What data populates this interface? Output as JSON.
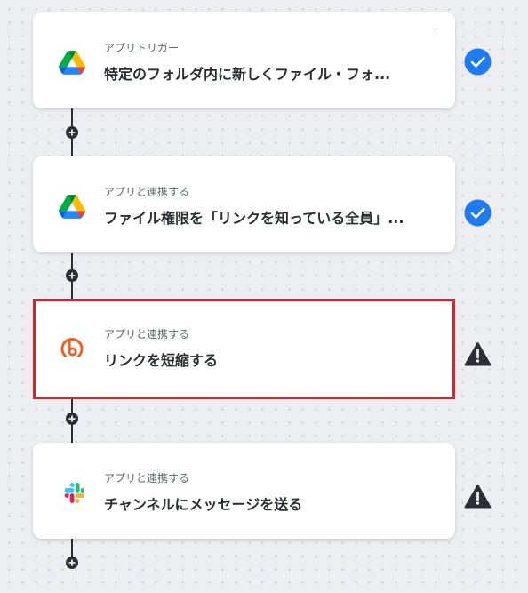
{
  "flow": {
    "steps": [
      {
        "subtitle": "アプリトリガー",
        "title": "特定のフォルダ内に新しくファイル・フォ...",
        "app_icon": "google-drive-icon",
        "status": "complete"
      },
      {
        "subtitle": "アプリと連携する",
        "title": "ファイル権限を「リンクを知っている全員」...",
        "app_icon": "google-drive-icon",
        "status": "complete"
      },
      {
        "subtitle": "アプリと連携する",
        "title": "リンクを短縮する",
        "app_icon": "bitly-icon",
        "status": "warning",
        "highlighted": true
      },
      {
        "subtitle": "アプリと連携する",
        "title": "チャンネルにメッセージを送る",
        "app_icon": "slack-icon",
        "status": "warning"
      }
    ]
  },
  "colors": {
    "complete": "#1e7bf0",
    "warning": "#2b2f33",
    "highlight_border": "#d6252b",
    "connector": "#2b2f33",
    "bitly": "#ee6123"
  }
}
